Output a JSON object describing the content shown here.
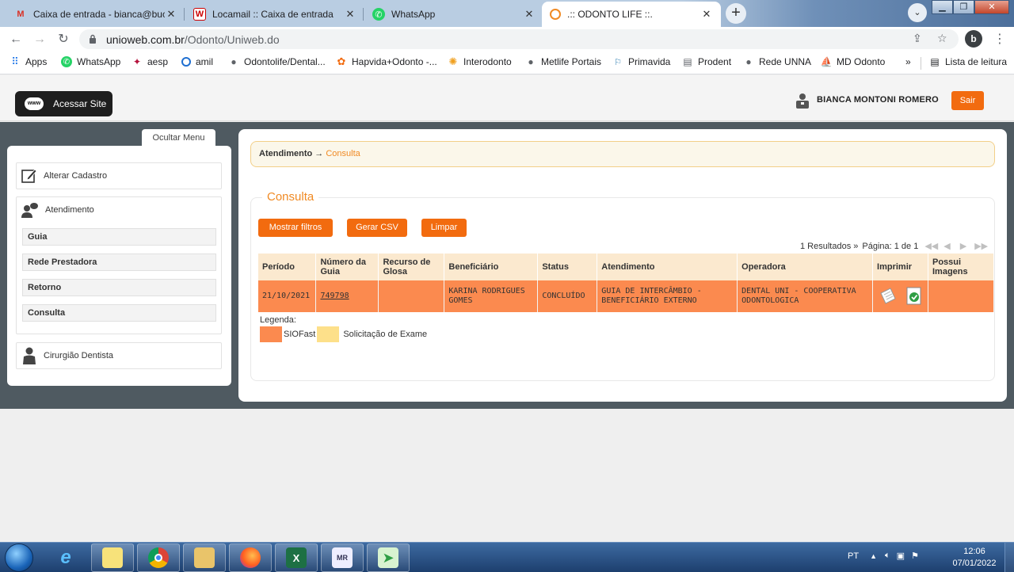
{
  "browser": {
    "tabs": [
      {
        "title": "Caixa de entrada - bianca@bucal",
        "favicon": "gmail-icon"
      },
      {
        "title": "Locamail :: Caixa de entrada",
        "favicon": "locamail-icon"
      },
      {
        "title": "WhatsApp",
        "favicon": "whatsapp-icon"
      },
      {
        "title": ".:: ODONTO LIFE ::.",
        "favicon": "odontolife-icon"
      }
    ],
    "url_host": "unioweb.com.br",
    "url_path": "/Odonto/Uniweb.do",
    "profile_letter": "b",
    "bookmarks": [
      {
        "label": "Apps"
      },
      {
        "label": "WhatsApp"
      },
      {
        "label": "aesp"
      },
      {
        "label": "amil"
      },
      {
        "label": "Odontolife/Dental..."
      },
      {
        "label": "Hapvida+Odonto -..."
      },
      {
        "label": "Interodonto"
      },
      {
        "label": "Metlife Portais"
      },
      {
        "label": "Primavida"
      },
      {
        "label": "Prodent"
      },
      {
        "label": "Rede UNNA"
      },
      {
        "label": "MD Odonto"
      }
    ],
    "reading_list": "Lista de leitura",
    "more_bookmarks": "»"
  },
  "header": {
    "access_site": "Acessar Site",
    "www_badge": "www",
    "user_name": "BIANCA MONTONI ROMERO",
    "logout": "Sair"
  },
  "sidebar": {
    "hide_menu": "Ocultar Menu",
    "alter_profile": "Alterar Cadastro",
    "attendance": "Atendimento",
    "attendance_items": [
      "Guia",
      "Rede Prestadora",
      "Retorno",
      "Consulta"
    ],
    "dentist": "Cirurgião Dentista"
  },
  "main": {
    "breadcrumb_root": "Atendimento",
    "breadcrumb_arrow": "→",
    "breadcrumb_current": "Consulta",
    "section_title": "Consulta",
    "buttons": {
      "filters": "Mostrar filtros",
      "csv": "Gerar CSV",
      "clear": "Limpar"
    },
    "results": "1 Resultados »",
    "page_info": "Página: 1 de 1",
    "columns": [
      "Período",
      "Número da Guia",
      "Recurso de Glosa",
      "Beneficiário",
      "Status",
      "Atendimento",
      "Operadora",
      "Imprimir",
      "Possui Imagens"
    ],
    "rows": [
      {
        "periodo": "21/10/2021",
        "numero_guia": "749798",
        "recurso_glosa": "",
        "beneficiario": "KARINA RODRIGUES GOMES",
        "status": "CONCLUÍDO",
        "atendimento": "GUIA DE INTERCÂMBIO - BENEFICIÁRIO EXTERNO",
        "operadora": "DENTAL UNI - COOPERATIVA ODONTOLOGICA",
        "possui_imagens": ""
      }
    ],
    "legend_label": "Legenda:",
    "legend": [
      {
        "label": "SIOFast",
        "color": "#fb8a4f"
      },
      {
        "label": "Solicitação de Exame",
        "color": "#fde08a"
      }
    ]
  },
  "taskbar": {
    "language": "PT",
    "time": "12:06",
    "date": "07/01/2022"
  },
  "colors": {
    "accent": "#f26b0f",
    "row_highlight": "#fb8a4f",
    "header_row": "#fbe9cf",
    "dark_band": "#4f5a61"
  }
}
